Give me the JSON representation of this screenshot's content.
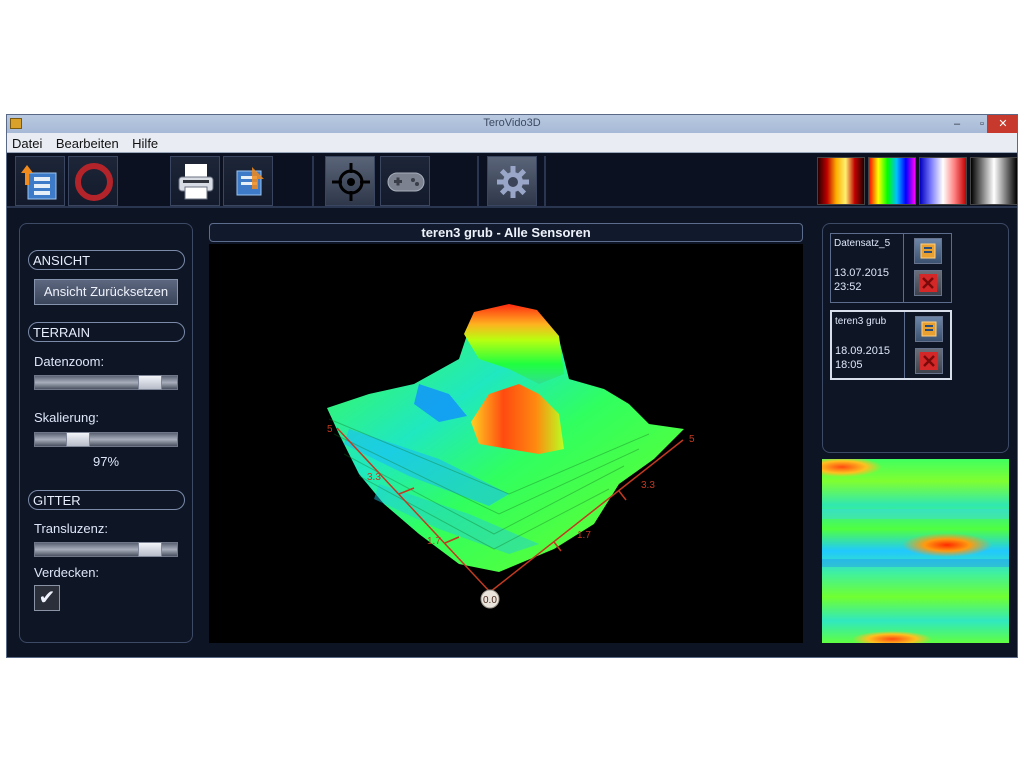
{
  "window": {
    "title": "TeroVido3D",
    "controls": {
      "minimize": "–",
      "maximize": "▫",
      "close": "✕"
    }
  },
  "menu": {
    "items": [
      "Datei",
      "Bearbeiten",
      "Hilfe"
    ]
  },
  "toolbar": {
    "buttons": [
      {
        "name": "load-file-icon"
      },
      {
        "name": "record-icon"
      },
      {
        "name": "print-icon"
      },
      {
        "name": "export-icon"
      },
      {
        "name": "crosshair-icon",
        "active": true
      },
      {
        "name": "gamepad-icon"
      },
      {
        "name": "settings-gear-icon"
      }
    ],
    "palettes": [
      {
        "name": "palette-heat",
        "colors": [
          "#2a0000",
          "#c00000",
          "#ffb000",
          "#fff070",
          "#c00000",
          "#200000"
        ]
      },
      {
        "name": "palette-rainbow",
        "colors": [
          "#ff0000",
          "#ffff00",
          "#00ff00",
          "#00c0ff",
          "#0000ff",
          "#ff00ff"
        ]
      },
      {
        "name": "palette-bluered",
        "colors": [
          "#0000c0",
          "#8080ff",
          "#ffffff",
          "#ff8080",
          "#c00000"
        ]
      },
      {
        "name": "palette-gray",
        "colors": [
          "#000000",
          "#ffffff",
          "#000000"
        ]
      }
    ]
  },
  "left": {
    "ansicht": {
      "header": "ANSICHT",
      "reset": "Ansicht Zurücksetzen"
    },
    "terrain": {
      "header": "TERRAIN",
      "datenzoom": {
        "label": "Datenzoom:",
        "value": 0.86
      },
      "skalierung": {
        "label": "Skalierung:",
        "value": 0.26,
        "display": "97%"
      }
    },
    "gitter": {
      "header": "GITTER",
      "transluzenz": {
        "label": "Transluzenz:",
        "value": 0.86
      },
      "verdecken": {
        "label": "Verdecken:",
        "checked": true,
        "mark": "✔"
      }
    }
  },
  "view": {
    "title": "teren3 grub - Alle Sensoren",
    "axes": {
      "left_max": "5",
      "left_mid1": "3.3",
      "left_mid2": "1.7",
      "right_max": "5",
      "right_mid1": "3.3",
      "right_mid2": "1.7",
      "origin": "0.0"
    }
  },
  "datasets": [
    {
      "name": "Datensatz_5",
      "date": "13.07.2015",
      "time": "23:52",
      "selected": false
    },
    {
      "name": "teren3 grub",
      "date": "18.09.2015",
      "time": "18:05",
      "selected": true
    }
  ]
}
